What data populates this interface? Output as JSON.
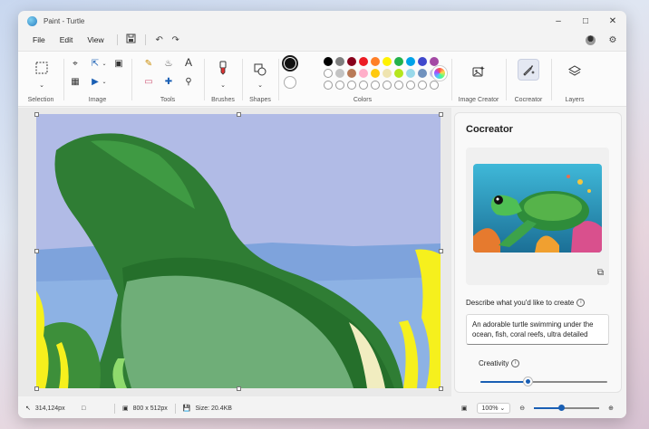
{
  "window": {
    "title": "Paint - Turtle"
  },
  "menu": {
    "file": "File",
    "edit": "Edit",
    "view": "View"
  },
  "ribbon": {
    "groups": {
      "selection": "Selection",
      "image": "Image",
      "tools": "Tools",
      "brushes": "Brushes",
      "shapes": "Shapes",
      "colors": "Colors",
      "image_creator": "Image Creator",
      "cocreator": "Cocreator",
      "layers": "Layers"
    },
    "primary_color": "#111111",
    "secondary_color": "#ffffff",
    "palette_row1": [
      "#000000",
      "#7f7f7f",
      "#88001b",
      "#ec1c24",
      "#ff7f27",
      "#fff200",
      "#22b14c",
      "#00a2e8",
      "#3f48cc",
      "#a349a4"
    ],
    "palette_row2": [
      "#ffffff",
      "#c3c3c3",
      "#b97a57",
      "#ffaec9",
      "#ffc90e",
      "#efe4b0",
      "#b5e61d",
      "#99d9ea",
      "#7092be",
      "#c8bfe7"
    ],
    "palette_row3_empty": 10
  },
  "panel": {
    "title": "Cocreator",
    "describe_label": "Describe what you'd like to create",
    "prompt": "An adorable turtle swimming under the ocean, fish, coral reefs, ultra detailed",
    "creativity_label": "Creativity",
    "creativity_fraction": 0.37
  },
  "status": {
    "cursor_pos": "314,124px",
    "canvas_size": "800  x  512px",
    "file_size": "Size: 20.4KB",
    "zoom_level": "100%",
    "zoom_fraction": 0.42
  },
  "colors": {
    "accent": "#1a5fb4"
  }
}
